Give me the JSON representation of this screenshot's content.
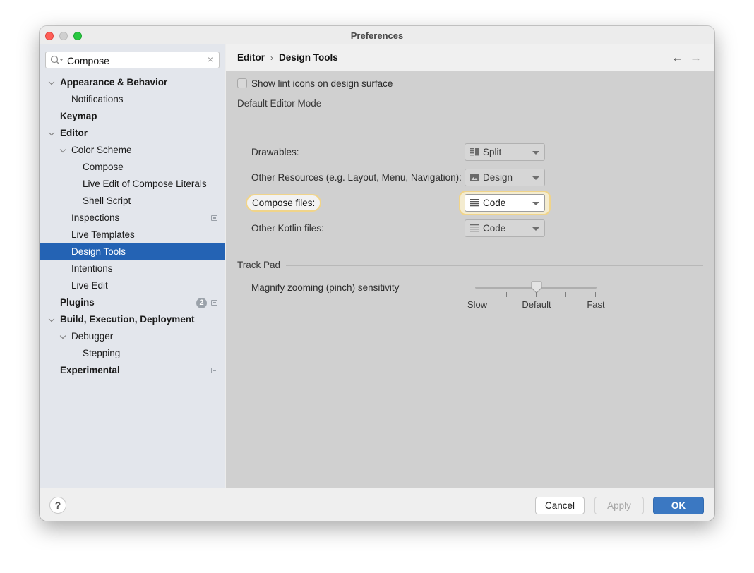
{
  "window": {
    "title": "Preferences"
  },
  "search": {
    "value": "Compose",
    "placeholder": ""
  },
  "sidebar": {
    "items": [
      {
        "label": "Appearance & Behavior",
        "level": 0,
        "bold": true,
        "expanded": true
      },
      {
        "label": "Notifications",
        "level": 1
      },
      {
        "label": "Keymap",
        "level": 0,
        "bold": true
      },
      {
        "label": "Editor",
        "level": 0,
        "bold": true,
        "expanded": true
      },
      {
        "label": "Color Scheme",
        "level": 1,
        "expanded": true
      },
      {
        "label": "Compose",
        "level": 2
      },
      {
        "label": "Live Edit of Compose Literals",
        "level": 2
      },
      {
        "label": "Shell Script",
        "level": 2
      },
      {
        "label": "Inspections",
        "level": 1,
        "project_icon": true
      },
      {
        "label": "Live Templates",
        "level": 1
      },
      {
        "label": "Design Tools",
        "level": 1,
        "selected": true
      },
      {
        "label": "Intentions",
        "level": 1
      },
      {
        "label": "Live Edit",
        "level": 1
      },
      {
        "label": "Plugins",
        "level": 0,
        "bold": true,
        "badge": "2",
        "project_icon": true
      },
      {
        "label": "Build, Execution, Deployment",
        "level": 0,
        "bold": true,
        "expanded": true
      },
      {
        "label": "Debugger",
        "level": 1,
        "expanded": true
      },
      {
        "label": "Stepping",
        "level": 2
      },
      {
        "label": "Experimental",
        "level": 0,
        "bold": true,
        "project_icon": true
      }
    ]
  },
  "header": {
    "breadcrumb": [
      "Editor",
      "Design Tools"
    ],
    "separator": "›",
    "back_icon": "←",
    "forward_icon": "→"
  },
  "settings": {
    "lint_checkbox": {
      "label": "Show lint icons on design surface",
      "checked": false
    },
    "default_editor_mode": {
      "title": "Default Editor Mode",
      "rows": [
        {
          "label": "Drawables:",
          "value": "Split",
          "icon": "split-icon"
        },
        {
          "label": "Other Resources (e.g. Layout, Menu, Navigation):",
          "value": "Design",
          "icon": "design-icon"
        },
        {
          "label": "Compose files:",
          "value": "Code",
          "icon": "code-icon",
          "highlighted": true
        },
        {
          "label": "Other Kotlin files:",
          "value": "Code",
          "icon": "code-icon"
        }
      ]
    },
    "track_pad": {
      "title": "Track Pad",
      "slider_label": "Magnify zooming (pinch) sensitivity",
      "ticks": [
        "Slow",
        "",
        "Default",
        "",
        "Fast"
      ],
      "value_index": 2,
      "tick_count": 5
    }
  },
  "footer": {
    "help_label": "?",
    "cancel_label": "Cancel",
    "apply_label": "Apply",
    "ok_label": "OK"
  },
  "colors": {
    "selection": "#2463b4",
    "ok_button": "#3b78c2",
    "highlight_ring": "#f0d48a"
  }
}
